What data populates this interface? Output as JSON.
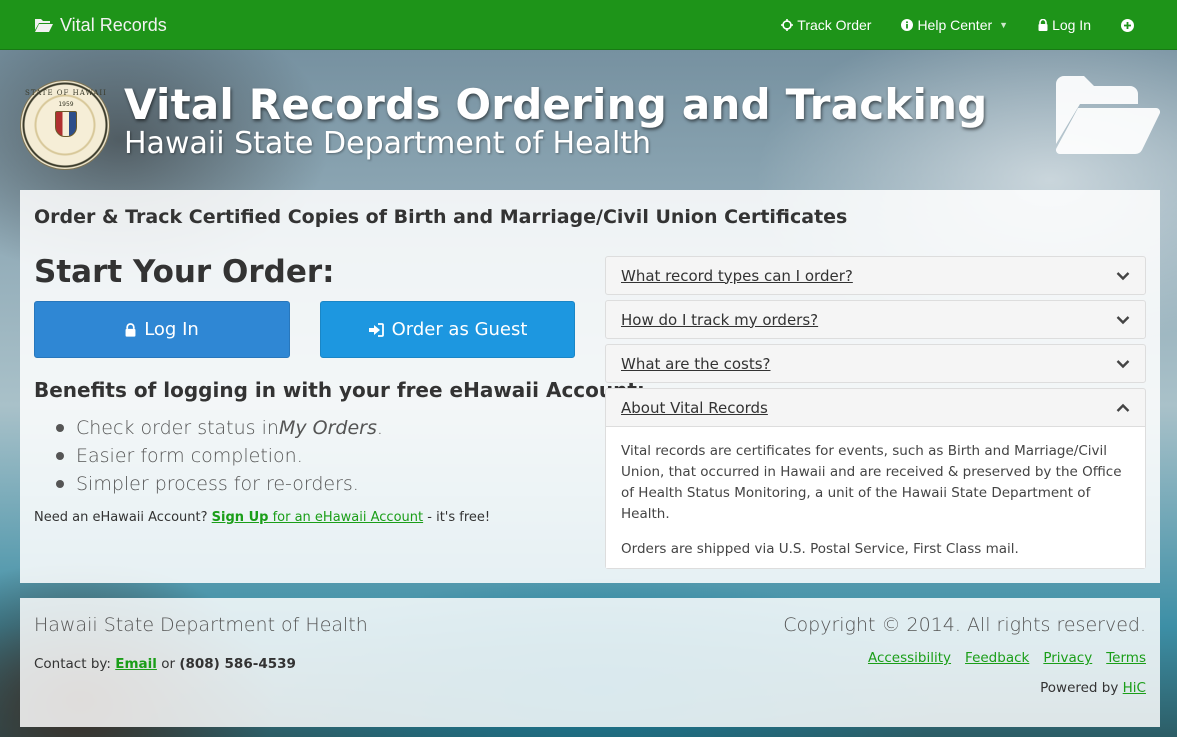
{
  "nav": {
    "brand": "Vital Records",
    "track_order": "Track Order",
    "help_center": "Help Center",
    "log_in": "Log In"
  },
  "header": {
    "title": "Vital Records Ordering and Tracking",
    "subtitle": "Hawaii State Department of Health",
    "seal_text": "STATE OF HAWAII",
    "seal_year": "1959"
  },
  "main": {
    "heading": "Order & Track Certified Copies of Birth and Marriage/Civil Union Certificates",
    "start_title": "Start Your Order:",
    "login_button": "Log In",
    "guest_button": "Order as Guest",
    "benefits_title": "Benefits of logging in with your free eHawaii Account:",
    "benefits": [
      {
        "before": "Check order status in ",
        "em": "My Orders",
        "after": "."
      },
      {
        "before": "Easier form completion.",
        "em": "",
        "after": ""
      },
      {
        "before": "Simpler process for re-orders.",
        "em": "",
        "after": ""
      }
    ],
    "need_prefix": "Need an eHawaii Account?",
    "signup_strong": "Sign Up",
    "signup_rest": " for an eHawaii Account",
    "need_suffix": " - it's free!"
  },
  "faq": {
    "items": [
      {
        "question": "What record types can I order?",
        "expanded": false
      },
      {
        "question": "How do I track my orders?",
        "expanded": false
      },
      {
        "question": "What are the costs?",
        "expanded": false
      },
      {
        "question": "About Vital Records",
        "expanded": true
      }
    ],
    "about_p1": "Vital records are certificates for events, such as Birth and Marriage/Civil Union, that occurred in Hawaii and are received & preserved by the Office of Health Status Monitoring, a unit of the Hawaii State Department of Health.",
    "about_p2": "Orders are shipped via U.S. Postal Service, First Class mail."
  },
  "footer": {
    "org": "Hawaii State Department of Health",
    "contact_prefix": "Contact by:",
    "email": "Email",
    "or": "or",
    "phone": "(808) 586-4539",
    "copyright": "Copyright © 2014. All rights reserved.",
    "links": [
      "Accessibility",
      "Feedback",
      "Privacy",
      "Terms"
    ],
    "powered_prefix": "Powered by",
    "powered_link": "HiC"
  },
  "colors": {
    "nav_green": "#1e9419",
    "login_blue": "#2f87d4",
    "guest_blue": "#1d97e0",
    "link_green": "#1a9e18"
  },
  "icons": [
    "folder-open-icon",
    "crosshairs-icon",
    "info-circle-icon",
    "lock-icon",
    "plus-circle-icon",
    "sign-in-icon",
    "chevron-down-icon",
    "chevron-up-icon"
  ]
}
